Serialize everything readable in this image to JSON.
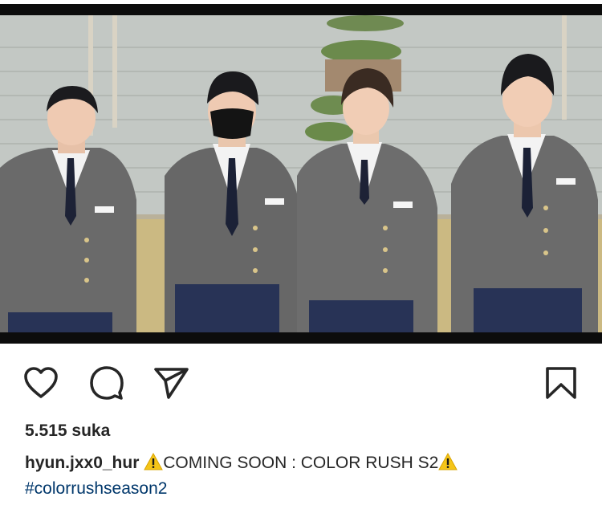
{
  "post": {
    "image_alt_icon": "photo-of-four-students-in-school-uniforms",
    "likes_text": "5.515 suka",
    "username": "hyun.jxx0_hur",
    "caption_text": "COMING SOON : COLOR RUSH S2",
    "hashtag": "#colorrushseason2"
  },
  "actions": {
    "like_icon": "heart-icon",
    "comment_icon": "comment-icon",
    "share_icon": "send-icon",
    "save_icon": "bookmark-icon"
  },
  "colors": {
    "text": "#262626",
    "hashtag": "#00376b",
    "warning": "#f5c518"
  }
}
